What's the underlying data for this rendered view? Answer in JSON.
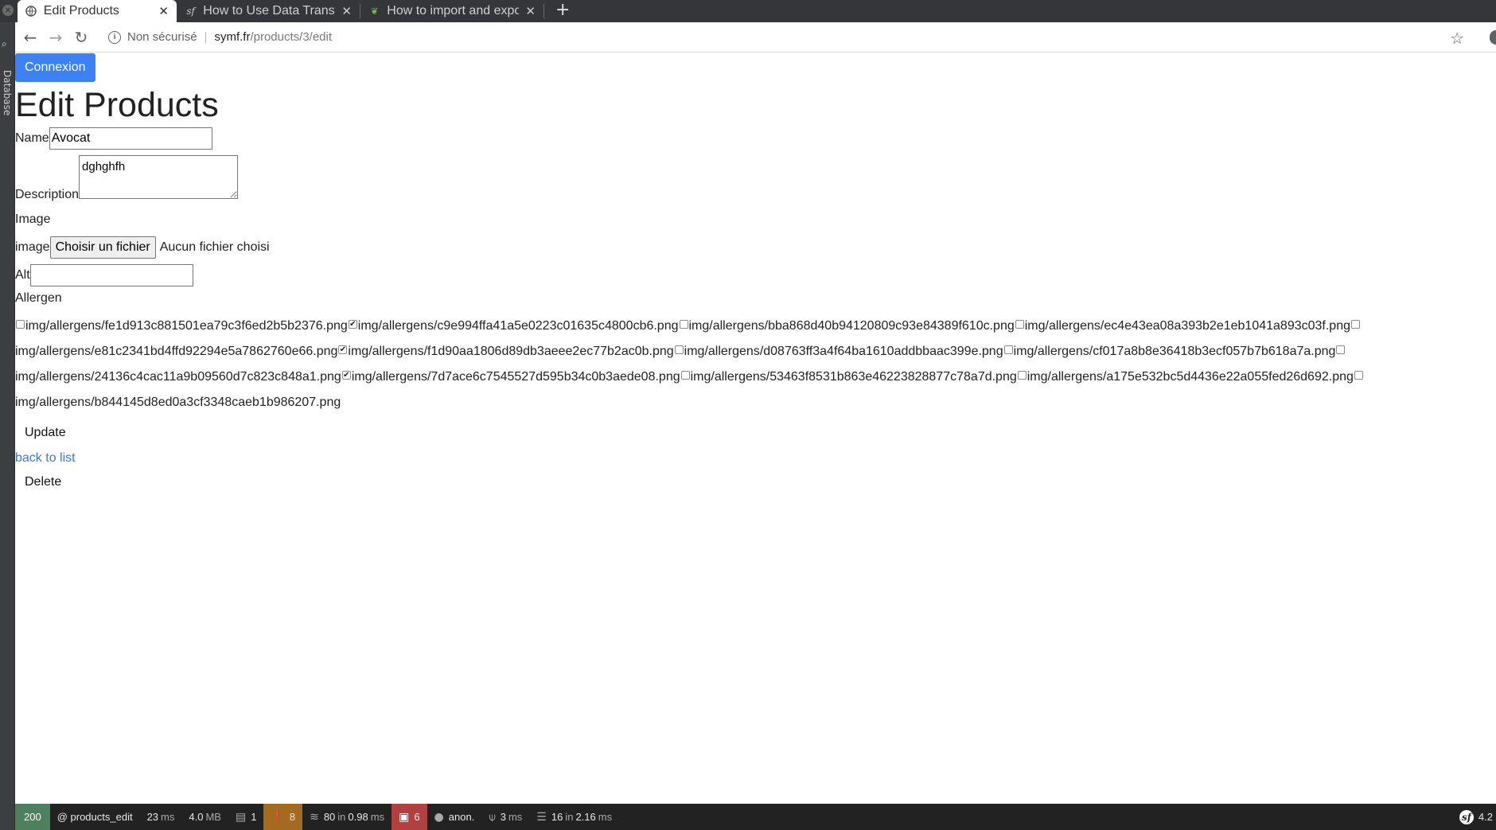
{
  "browser": {
    "tabs": [
      {
        "title": "Edit Products",
        "favicon": "globe-icon"
      },
      {
        "title": "How to Use Data Transfor",
        "favicon": "symfony-icon"
      },
      {
        "title": "How to import and expor",
        "favicon": "leaf-icon"
      }
    ],
    "security": "Non sécurisé",
    "url_host": "symf.fr",
    "url_path": "/products/3/edit"
  },
  "sidebar": {
    "label": "Database"
  },
  "page": {
    "connexion": "Connexion",
    "title": "Edit Products",
    "name_label": "Name",
    "name_value": "Avocat",
    "description_label": "Description",
    "description_value": "dghghfh",
    "image_section": "Image",
    "image_label": "image",
    "file_button": "Choisir un fichier",
    "file_status": "Aucun fichier choisi",
    "alt_label": "Alt",
    "alt_value": "",
    "allergen_label": "Allergen",
    "allergens": [
      {
        "path": "img/allergens/fe1d913c881501ea79c3f6ed2b5b2376.png",
        "checked": false
      },
      {
        "path": "img/allergens/c9e994ffa41a5e0223c01635c4800cb6.png",
        "checked": true
      },
      {
        "path": "img/allergens/bba868d40b94120809c93e84389f610c.png",
        "checked": false
      },
      {
        "path": "img/allergens/ec4e43ea08a393b2e1eb1041a893c03f.png",
        "checked": false
      },
      {
        "path": "img/allergens/e81c2341bd4ffd92294e5a7862760e66.png",
        "checked": false
      },
      {
        "path": "img/allergens/f1d90aa1806d89db3aeee2ec77b2ac0b.png",
        "checked": true
      },
      {
        "path": "img/allergens/d08763ff3a4f64ba1610addbbaac399e.png",
        "checked": false
      },
      {
        "path": "img/allergens/cf017a8b8e36418b3ecf057b7b618a7a.png",
        "checked": false
      },
      {
        "path": "img/allergens/24136c4cac11a9b09560d7c823c848a1.png",
        "checked": false
      },
      {
        "path": "img/allergens/7d7ace6c7545527d595b34c0b3aede08.png",
        "checked": true
      },
      {
        "path": "img/allergens/53463f8531b863e46223828877c78a7d.png",
        "checked": false
      },
      {
        "path": "img/allergens/a175e532bc5d4436e22a055fed26d692.png",
        "checked": false
      },
      {
        "path": "img/allergens/b844145d8ed0a3cf3348caeb1b986207.png",
        "checked": false
      }
    ],
    "update_button": "Update",
    "back_link": "back to list",
    "delete_button": "Delete"
  },
  "debug_toolbar": {
    "status_code": "200",
    "route": "@ products_edit",
    "time": "23",
    "time_unit": "ms",
    "memory": "4.0",
    "memory_unit": "MB",
    "forms": "1",
    "logs": "8",
    "cache_count": "80",
    "cache_in": "in",
    "cache_time": "0.98",
    "cache_unit": "ms",
    "translations": "6",
    "user": "anon.",
    "twig_time": "3",
    "twig_unit": "ms",
    "db_queries": "16",
    "db_in": "in",
    "db_time": "2.16",
    "db_unit": "ms",
    "version": "4.2"
  }
}
